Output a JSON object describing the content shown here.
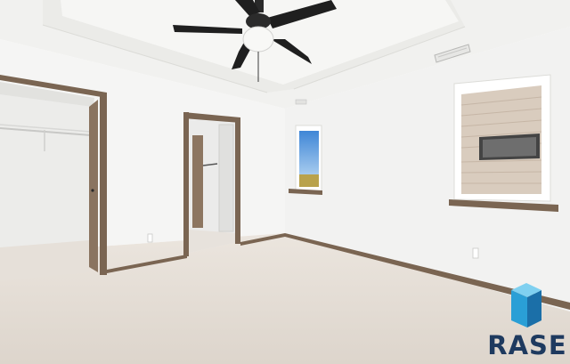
{
  "watermark": {
    "text": "RASE",
    "text_color": "#1e3a5f",
    "cube_colors": [
      "#2a9fd6",
      "#1b6fa8",
      "#7fd0f0"
    ]
  },
  "palette": {
    "wall": "#f3f3f2",
    "ceiling": "#f1f1ef",
    "carpet": "#e4ddd5",
    "trim": "#7a6552"
  },
  "features": [
    "ceiling-fan",
    "tray-ceiling",
    "walk-in-closet",
    "bathroom-doorway",
    "window",
    "window-with-siding-view",
    "hvac-vent",
    "carpet-floor"
  ]
}
